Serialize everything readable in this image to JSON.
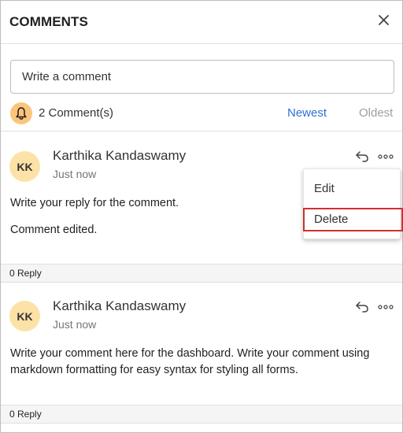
{
  "header": {
    "title": "COMMENTS"
  },
  "input": {
    "placeholder": "Write a comment"
  },
  "summary": {
    "count_label": "2 Comment(s)",
    "newest_label": "Newest",
    "oldest_label": "Oldest"
  },
  "threads": [
    {
      "avatar_initials": "KK",
      "author": "Karthika Kandaswamy",
      "time": "Just now",
      "lines": [
        "Write your reply for the comment.",
        "Comment edited."
      ],
      "reply_count": "0 Reply"
    },
    {
      "avatar_initials": "KK",
      "author": "Karthika Kandaswamy",
      "time": "Just now",
      "lines": [
        "Write your comment here for the dashboard. Write your comment using markdown formatting for easy syntax for styling all forms."
      ],
      "reply_count": "0 Reply"
    }
  ],
  "menu": {
    "items": [
      "Edit",
      "Delete"
    ],
    "highlighted": "Delete"
  },
  "colors": {
    "accent": "#2f6fd4",
    "avatar_bg": "#fde2a8",
    "bell_bg": "#fcc57c",
    "highlight_border": "#d32f2f"
  },
  "icons": {
    "close": "close-icon",
    "bell": "bell-icon",
    "reply": "reply-icon",
    "more": "more-horizontal-icon"
  }
}
